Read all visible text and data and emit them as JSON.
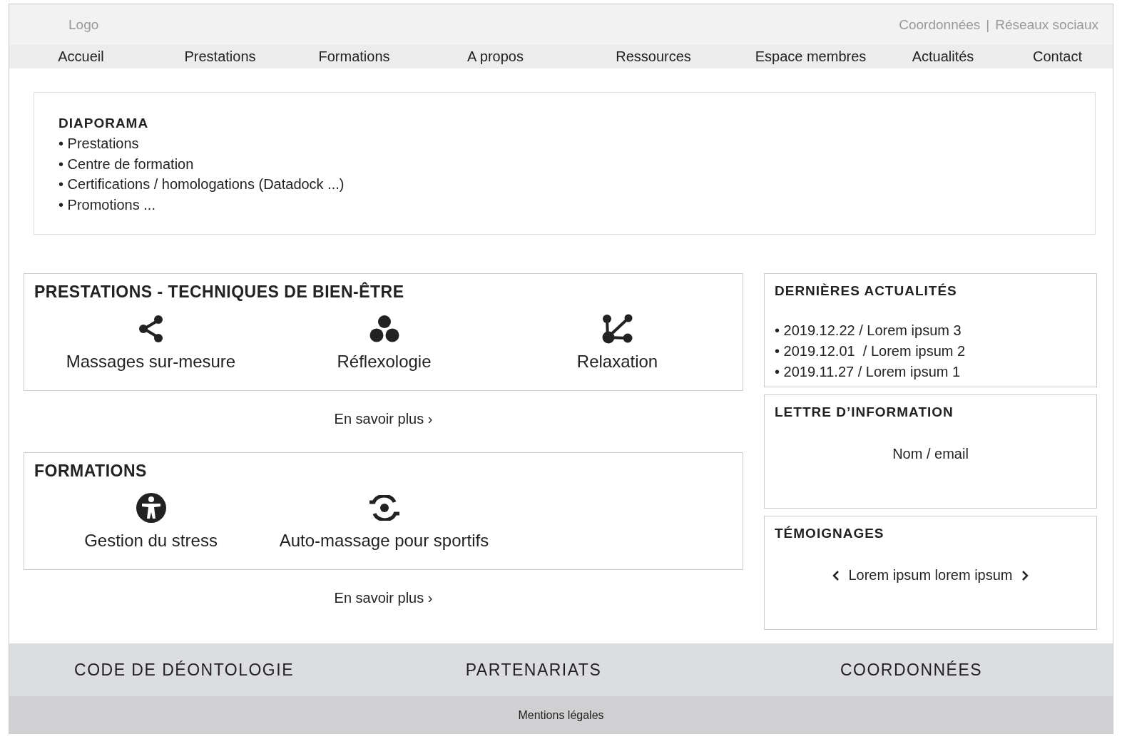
{
  "header": {
    "logo": "Logo",
    "links": [
      "Coordonnées",
      "|",
      "Réseaux sociaux"
    ]
  },
  "nav": [
    {
      "label": "Accueil"
    },
    {
      "label": "Prestations"
    },
    {
      "label": "Formations"
    },
    {
      "label": "A propos"
    },
    {
      "label": "Ressources"
    },
    {
      "label": "Espace membres"
    },
    {
      "label": "Actualités"
    },
    {
      "label": "Contact"
    }
  ],
  "slideshow": {
    "title": "DIAPORAMA",
    "items": [
      "• Prestations",
      "• Centre de formation",
      "• Certifications / homologations (Datadock ...)",
      "• Promotions ..."
    ]
  },
  "sections": [
    {
      "title": "PRESTATIONS - TECHNIQUES DE BIEN-ÊTRE",
      "items": [
        {
          "kind": "share",
          "label": "Massages sur-mesure"
        },
        {
          "kind": "dots",
          "label": "Réflexologie"
        },
        {
          "kind": "graph",
          "label": "Relaxation"
        }
      ],
      "more": "En savoir plus ›"
    },
    {
      "title": "FORMATIONS",
      "items": [
        {
          "kind": "person",
          "label": "Gestion du stress"
        },
        {
          "kind": "sync",
          "label": "Auto-massage pour sportifs"
        }
      ],
      "more": "En savoir plus ›"
    }
  ],
  "news": {
    "title": "DERNIÈRES ACTUALITÉS",
    "items": [
      "• 2019.12.22 / Lorem ipsum 3",
      "• 2019.12.01  / Lorem ipsum 2",
      "• 2019.11.27 / Lorem ipsum 1"
    ]
  },
  "newsletter": {
    "title": "LETTRE D’INFORMATION",
    "placeholder": "Nom / email"
  },
  "testimonials": {
    "title": "TÉMOIGNAGES",
    "quote": "Lorem ipsum lorem ipsum"
  },
  "footer": {
    "links": [
      "CODE DE DÉONTOLOGIE",
      "PARTENARIATS",
      "COORDONNÉES"
    ],
    "legal": "Mentions légales"
  }
}
